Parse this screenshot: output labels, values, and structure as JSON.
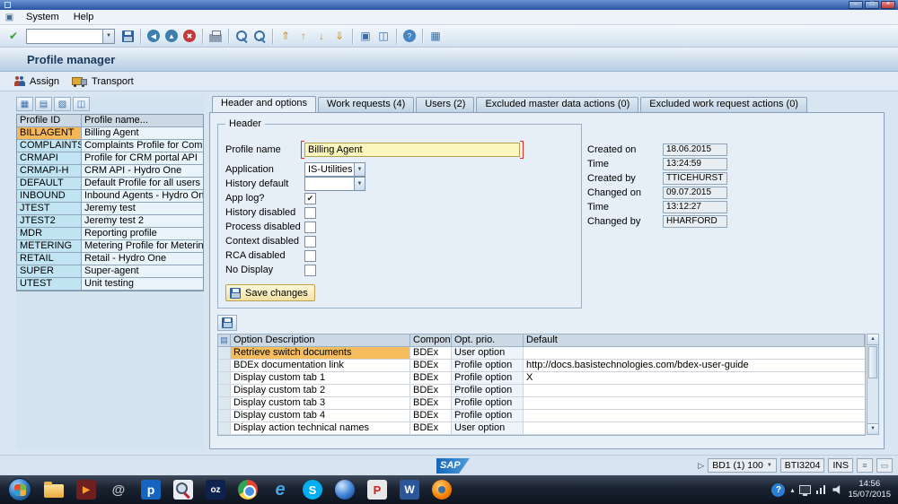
{
  "window": {
    "menu_items": [
      "System",
      "Help"
    ],
    "min_label": "–",
    "max_label": "□",
    "close_label": "×"
  },
  "title": "Profile manager",
  "toolbar": {
    "command_value": "",
    "icons": [
      {
        "name": "save-icon",
        "kind": "floppy"
      },
      {
        "name": "sep",
        "kind": "sep"
      },
      {
        "name": "back-icon",
        "kind": "circle",
        "glyph": "◀",
        "color": "#3f7fae"
      },
      {
        "name": "exit-icon",
        "kind": "circle",
        "glyph": "▲",
        "color": "#3f7fae"
      },
      {
        "name": "cancel-icon",
        "kind": "circle",
        "glyph": "✖",
        "color": "#c23b3b"
      },
      {
        "name": "sep",
        "kind": "sep"
      },
      {
        "name": "print-icon",
        "kind": "printer"
      },
      {
        "name": "sep",
        "kind": "sep"
      },
      {
        "name": "find-icon",
        "kind": "mag"
      },
      {
        "name": "find-next-icon",
        "kind": "mag"
      },
      {
        "name": "sep",
        "kind": "sep"
      },
      {
        "name": "first-page-icon",
        "kind": "glyph",
        "glyph": "⇑",
        "color": "#c89428"
      },
      {
        "name": "previous-page-icon",
        "kind": "glyph",
        "glyph": "↑",
        "color": "#c89428"
      },
      {
        "name": "next-page-icon",
        "kind": "glyph",
        "glyph": "↓",
        "color": "#c89428"
      },
      {
        "name": "last-page-icon",
        "kind": "glyph",
        "glyph": "⇓",
        "color": "#c89428"
      },
      {
        "name": "sep",
        "kind": "sep"
      },
      {
        "name": "new-session-icon",
        "kind": "glyph",
        "glyph": "▣",
        "color": "#3a6ea5"
      },
      {
        "name": "create-shortcut-icon",
        "kind": "glyph",
        "glyph": "◫",
        "color": "#3a6ea5"
      },
      {
        "name": "sep",
        "kind": "sep"
      },
      {
        "name": "help-icon",
        "kind": "circle",
        "glyph": "?",
        "color": "#4784c4"
      },
      {
        "name": "sep",
        "kind": "sep"
      },
      {
        "name": "customize-layout-icon",
        "kind": "glyph",
        "glyph": "▦",
        "color": "#3a6ea5"
      }
    ],
    "enter_icon": {
      "name": "enter-icon",
      "glyph": "✔",
      "color": "#3a9a3a"
    }
  },
  "app_toolbar": {
    "assign": "Assign",
    "transport": "Transport"
  },
  "left_panel": {
    "toolbar_icons": [
      {
        "name": "select-layout-icon",
        "glyph": "▦",
        "color": "#3a6ea5"
      },
      {
        "name": "sort-icon",
        "glyph": "▤",
        "color": "#3a6ea5"
      },
      {
        "name": "filter-icon",
        "glyph": "▧",
        "color": "#3a6ea5"
      },
      {
        "name": "export-icon",
        "glyph": "◫",
        "color": "#3a6ea5"
      }
    ],
    "headers": [
      "Profile ID",
      "Profile name..."
    ],
    "profiles": [
      {
        "id": "BILLAGENT",
        "name": "Billing Agent",
        "selected": true
      },
      {
        "id": "COMPLAINTS",
        "name": "Complaints Profile for Compla",
        "selected": false
      },
      {
        "id": "CRMAPI",
        "name": "Profile for CRM portal API",
        "selected": false
      },
      {
        "id": "CRMAPI-H",
        "name": "CRM API - Hydro One",
        "selected": false
      },
      {
        "id": "DEFAULT",
        "name": "Default Profile for all users",
        "selected": false
      },
      {
        "id": "INBOUND",
        "name": "Inbound Agents - Hydro One",
        "selected": false
      },
      {
        "id": "JTEST",
        "name": "Jeremy test",
        "selected": false
      },
      {
        "id": "JTEST2",
        "name": "Jeremy test 2",
        "selected": false
      },
      {
        "id": "MDR",
        "name": "Reporting profile",
        "selected": false
      },
      {
        "id": "METERING",
        "name": "Metering Profile for Metering",
        "selected": false
      },
      {
        "id": "RETAIL",
        "name": "Retail - Hydro One",
        "selected": false
      },
      {
        "id": "SUPER",
        "name": "Super-agent",
        "selected": false
      },
      {
        "id": "UTEST",
        "name": "Unit testing",
        "selected": false
      }
    ]
  },
  "tabs": [
    {
      "label": "Header and options",
      "active": true
    },
    {
      "label": "Work requests (4)",
      "active": false
    },
    {
      "label": "Users (2)",
      "active": false
    },
    {
      "label": "Excluded master data actions (0)",
      "active": false
    },
    {
      "label": "Excluded work request actions (0)",
      "active": false
    }
  ],
  "header_form": {
    "group_title": "Header",
    "profile_name": {
      "label": "Profile name",
      "value": "Billing Agent"
    },
    "application": {
      "label": "Application",
      "value": "IS-Utilities"
    },
    "history_default": {
      "label": "History default",
      "value": ""
    },
    "checkboxes": [
      {
        "label": "App log?",
        "checked": true
      },
      {
        "label": "History disabled",
        "checked": false
      },
      {
        "label": "Process disabled",
        "checked": false
      },
      {
        "label": "Context disabled",
        "checked": false
      },
      {
        "label": "RCA disabled",
        "checked": false
      },
      {
        "label": "No Display",
        "checked": false
      }
    ],
    "save_button": "Save changes",
    "audit": [
      {
        "label": "Created on",
        "value": "18.06.2015"
      },
      {
        "label": "Time",
        "value": "13:24:59"
      },
      {
        "label": "Created by",
        "value": "TTICEHURST"
      },
      {
        "label": "Changed on",
        "value": "09.07.2015"
      },
      {
        "label": "Time",
        "value": "13:12:27"
      },
      {
        "label": "Changed by",
        "value": "HHARFORD"
      }
    ]
  },
  "options_table": {
    "headers": [
      "Option Description",
      "Component",
      "Opt. prio.",
      "Default"
    ],
    "rows": [
      {
        "description": "Retrieve switch documents",
        "component": "BDEx",
        "priority": "User option",
        "default": "",
        "selected": true
      },
      {
        "description": "BDEx documentation link",
        "component": "BDEx",
        "priority": "Profile option",
        "default": "http://docs.basistechnologies.com/bdex-user-guide",
        "selected": false
      },
      {
        "description": "Display custom tab 1",
        "component": "BDEx",
        "priority": "Profile option",
        "default": "X",
        "selected": false
      },
      {
        "description": "Display custom tab 2",
        "component": "BDEx",
        "priority": "Profile option",
        "default": "",
        "selected": false
      },
      {
        "description": "Display custom tab 3",
        "component": "BDEx",
        "priority": "Profile option",
        "default": "",
        "selected": false
      },
      {
        "description": "Display custom tab 4",
        "component": "BDEx",
        "priority": "Profile option",
        "default": "",
        "selected": false
      },
      {
        "description": "Display action technical names",
        "component": "BDEx",
        "priority": "User option",
        "default": "",
        "selected": false
      }
    ]
  },
  "status_bar": {
    "sap_logo": "SAP",
    "system": "BD1 (1) 100",
    "server": "BTI3204",
    "mode": "INS",
    "icons": [
      {
        "name": "response-time-icon",
        "glyph": "≡"
      },
      {
        "name": "connection-icon",
        "glyph": "▭"
      }
    ]
  },
  "taskbar": {
    "icons": [
      {
        "name": "start-button",
        "kind": "orb"
      },
      {
        "name": "explorer-icon",
        "kind": "folder"
      },
      {
        "name": "media-player-icon",
        "kind": "square",
        "bg": "#6e1f1f",
        "glyph": "▶",
        "fg": "#ff9c30",
        "fs": 10
      },
      {
        "name": "swirl-app-icon",
        "kind": "square",
        "bg": "transparent",
        "glyph": "@",
        "fg": "#b9c0c8",
        "fs": 15
      },
      {
        "name": "p-app-icon",
        "kind": "square",
        "bg": "#1565c0",
        "glyph": "p",
        "fg": "#ffffff",
        "fs": 14
      },
      {
        "name": "search-tool-icon",
        "kind": "mag"
      },
      {
        "name": "oz-app-icon",
        "kind": "square",
        "bg": "#0e2250",
        "glyph": "oz",
        "fg": "#ffffff",
        "fs": 10
      },
      {
        "name": "chrome-icon",
        "kind": "chrome"
      },
      {
        "name": "ie-icon",
        "kind": "ie",
        "glyph": "e"
      },
      {
        "name": "skype-icon",
        "kind": "circle",
        "bg": "#00aff0",
        "glyph": "S",
        "fg": "#ffffff",
        "fs": 13
      },
      {
        "name": "blue-globe-icon",
        "kind": "globe"
      },
      {
        "name": "pdf-app-icon",
        "kind": "square",
        "bg": "#e8e8e8",
        "glyph": "P",
        "fg": "#cc2222",
        "fs": 13
      },
      {
        "name": "word-icon",
        "kind": "square",
        "bg": "#2b579a",
        "glyph": "W",
        "fg": "#ffffff",
        "fs": 12
      },
      {
        "name": "firefox-icon",
        "kind": "firefox"
      }
    ],
    "tray_icons": [
      {
        "name": "help-icon",
        "cls": "tr-help",
        "glyph": "?"
      },
      {
        "name": "hidden-icons-icon",
        "cls": "tr-chev",
        "glyph": "▴"
      },
      {
        "name": "display-icon",
        "cls": "tr-mon"
      },
      {
        "name": "network-icon",
        "cls": "tr-bars"
      },
      {
        "name": "volume-icon",
        "cls": "tr-spk"
      }
    ],
    "tray": {
      "time": "14:56",
      "date": "15/07/2015"
    }
  }
}
